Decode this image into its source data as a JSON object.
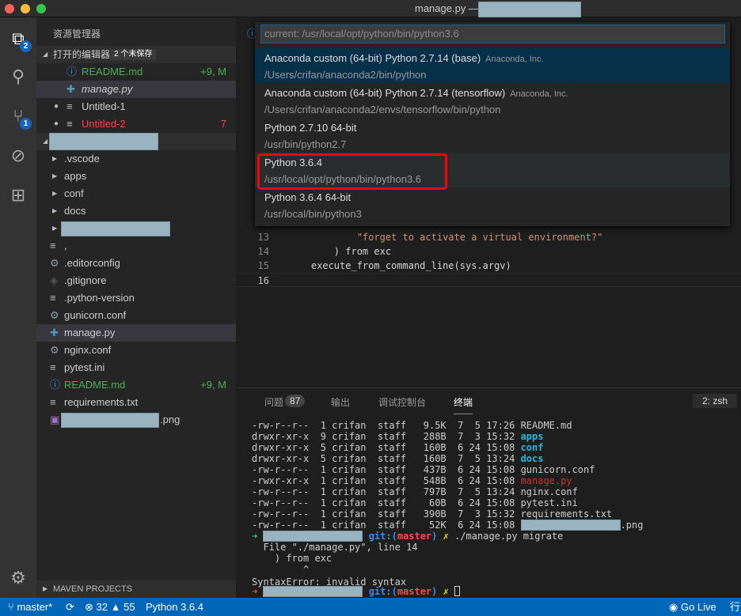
{
  "window": {
    "title": "manage.py —"
  },
  "activity": {
    "explorer_badge": "2",
    "scm_badge": "1"
  },
  "sidebar": {
    "title": "资源管理器",
    "open_editors": {
      "label": "打开的编辑器",
      "unsaved": "2 个未保存",
      "items": [
        {
          "name": "README.md",
          "status": "+9, M",
          "color": "#4caf50",
          "icon": "info-icon"
        },
        {
          "name": "manage.py",
          "status": "",
          "color": "#ccc",
          "icon": "python-icon"
        },
        {
          "name": "Untitled-1",
          "status": "",
          "color": "#ccc",
          "icon": "text-file-icon"
        },
        {
          "name": "Untitled-2",
          "status": "7",
          "color": "#f44747",
          "icon": "text-file-icon"
        }
      ]
    },
    "tree": [
      {
        "name": ".vscode",
        "type": "folder"
      },
      {
        "name": "apps",
        "type": "folder"
      },
      {
        "name": "conf",
        "type": "folder"
      },
      {
        "name": "docs",
        "type": "folder"
      },
      {
        "name": "",
        "type": "folder-redacted"
      },
      {
        "name": ",",
        "type": "file"
      },
      {
        "name": ".editorconfig",
        "type": "gear"
      },
      {
        "name": ".gitignore",
        "type": "git"
      },
      {
        "name": ".python-version",
        "type": "file"
      },
      {
        "name": "gunicorn.conf",
        "type": "gear"
      },
      {
        "name": "manage.py",
        "type": "python"
      },
      {
        "name": "nginx.conf",
        "type": "gear"
      },
      {
        "name": "pytest.ini",
        "type": "file"
      },
      {
        "name": "README.md",
        "type": "info",
        "status": "+9, M"
      },
      {
        "name": "requirements.txt",
        "type": "file"
      },
      {
        "name": ".png",
        "type": "image-redacted"
      }
    ],
    "maven": "MAVEN PROJECTS"
  },
  "editor": {
    "lines": [
      {
        "n": "13",
        "code": "            \"forget to activate a virtual environment?\""
      },
      {
        "n": "14",
        "code": "        ) from exc"
      },
      {
        "n": "15",
        "code": "    execute_from_command_line(sys.argv)"
      },
      {
        "n": "16",
        "code": ""
      }
    ]
  },
  "quick_pick": {
    "placeholder": "current: /usr/local/opt/python/bin/python3.6",
    "items": [
      {
        "label": "Anaconda custom (64-bit) Python 2.7.14 (base)",
        "desc": "Anaconda, Inc.",
        "path": "/Users/crifan/anaconda2/bin/python"
      },
      {
        "label": "Anaconda custom (64-bit) Python 2.7.14 (tensorflow)",
        "desc": "Anaconda, Inc.",
        "path": "/Users/crifan/anaconda2/envs/tensorflow/bin/python"
      },
      {
        "label": "Python 2.7.10 64-bit",
        "desc": "",
        "path": "/usr/bin/python2.7"
      },
      {
        "label": "Python 3.6.4",
        "desc": "",
        "path": "/usr/local/opt/python/bin/python3.6"
      },
      {
        "label": "Python 3.6.4 64-bit",
        "desc": "",
        "path": "/usr/local/bin/python3"
      }
    ]
  },
  "panel": {
    "tabs": [
      "问题",
      "输出",
      "调试控制台",
      "终端"
    ],
    "problems_count": "87",
    "terminal_select": "2: zsh",
    "ls": [
      [
        "-rw-r--r--  1 crifan  staff   9.5K  7  5 17:26 ",
        "README.md",
        "#ccc"
      ],
      [
        "drwxr-xr-x  9 crifan  staff   288B  7  3 15:32 ",
        "apps",
        "#29b8db"
      ],
      [
        "drwxr-xr-x  5 crifan  staff   160B  6 24 15:08 ",
        "conf",
        "#29b8db"
      ],
      [
        "drwxr-xr-x  5 crifan  staff   160B  7  5 13:24 ",
        "docs",
        "#29b8db"
      ],
      [
        "-rw-r--r--  1 crifan  staff   437B  6 24 15:08 ",
        "gunicorn.conf",
        "#ccc"
      ],
      [
        "-rwxr-xr-x  1 crifan  staff   548B  6 24 15:08 ",
        "manage.py",
        "#cd3131"
      ],
      [
        "-rw-r--r--  1 crifan  staff   797B  7  5 13:24 ",
        "nginx.conf",
        "#ccc"
      ],
      [
        "-rw-r--r--  1 crifan  staff    60B  6 24 15:08 ",
        "pytest.ini",
        "#ccc"
      ],
      [
        "-rw-r--r--  1 crifan  staff   390B  7  3 15:32 ",
        "requirements.txt",
        "#ccc"
      ],
      [
        "-rw-r--r--  1 crifan  staff    52K  6 24 15:08 ",
        ".png",
        "#ccc"
      ]
    ],
    "git_prefix": "git:(",
    "branch": "master",
    "git_suffix": ")",
    "dirty": "✗",
    "command": "./manage.py migrate",
    "out": [
      "  File \"./manage.py\", line 14",
      "    ) from exc",
      "         ^",
      "SyntaxError: invalid syntax"
    ]
  },
  "status": {
    "branch": "master*",
    "errors": "32",
    "warnings": "55",
    "interpreter": "Python 3.6.4",
    "golive": "Go Live",
    "line": "行"
  },
  "colors": {
    "status_bar": "#0066b8",
    "highlight_box": "#ff0000",
    "selected_item": "#062f4a"
  }
}
